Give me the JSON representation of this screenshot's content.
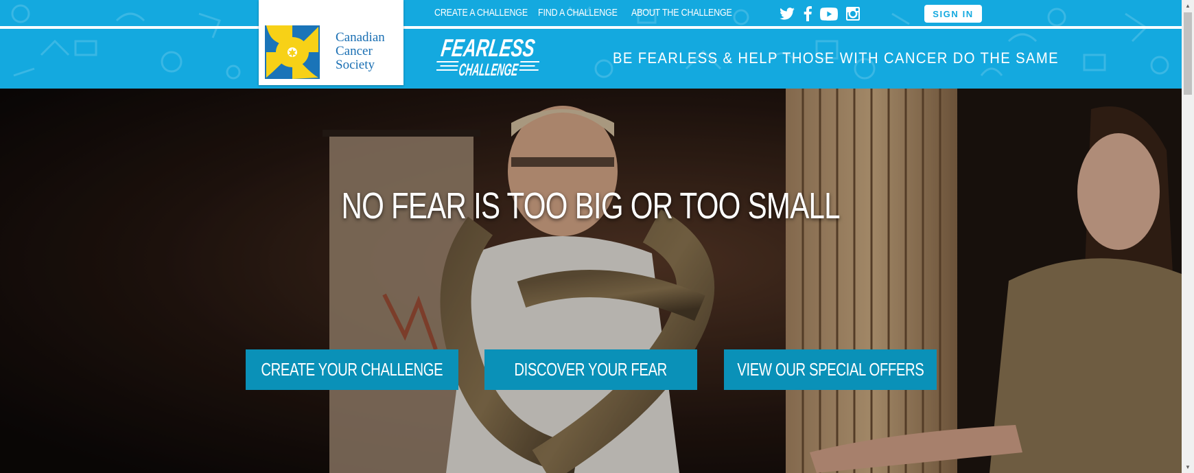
{
  "header": {
    "nav": [
      {
        "label": "CREATE A CHALLENGE"
      },
      {
        "label": "FIND A CHALLENGE"
      },
      {
        "label": "ABOUT THE CHALLENGE"
      }
    ],
    "social_icons": [
      "twitter-icon",
      "facebook-icon",
      "youtube-icon",
      "instagram-icon"
    ],
    "signin_label": "SIGN IN",
    "logo": {
      "line1": "Canadian",
      "line2": "Cancer",
      "line3": "Society"
    },
    "brand": {
      "word1": "FEARLESS",
      "word2": "CHALLENGE"
    },
    "tagline": "BE FEARLESS & HELP THOSE WITH CANCER DO THE SAME"
  },
  "hero": {
    "headline": "NO FEAR IS TOO BIG OR TOO SMALL",
    "buttons": [
      {
        "label": "CREATE YOUR CHALLENGE"
      },
      {
        "label": "DISCOVER YOUR FEAR"
      },
      {
        "label": "VIEW OUR SPECIAL OFFERS"
      }
    ]
  },
  "colors": {
    "header_blue": "#14a9df",
    "cta_blue": "#0a91b8",
    "logo_blue": "#1a74b8",
    "daffodil_yellow": "#f7d117"
  }
}
